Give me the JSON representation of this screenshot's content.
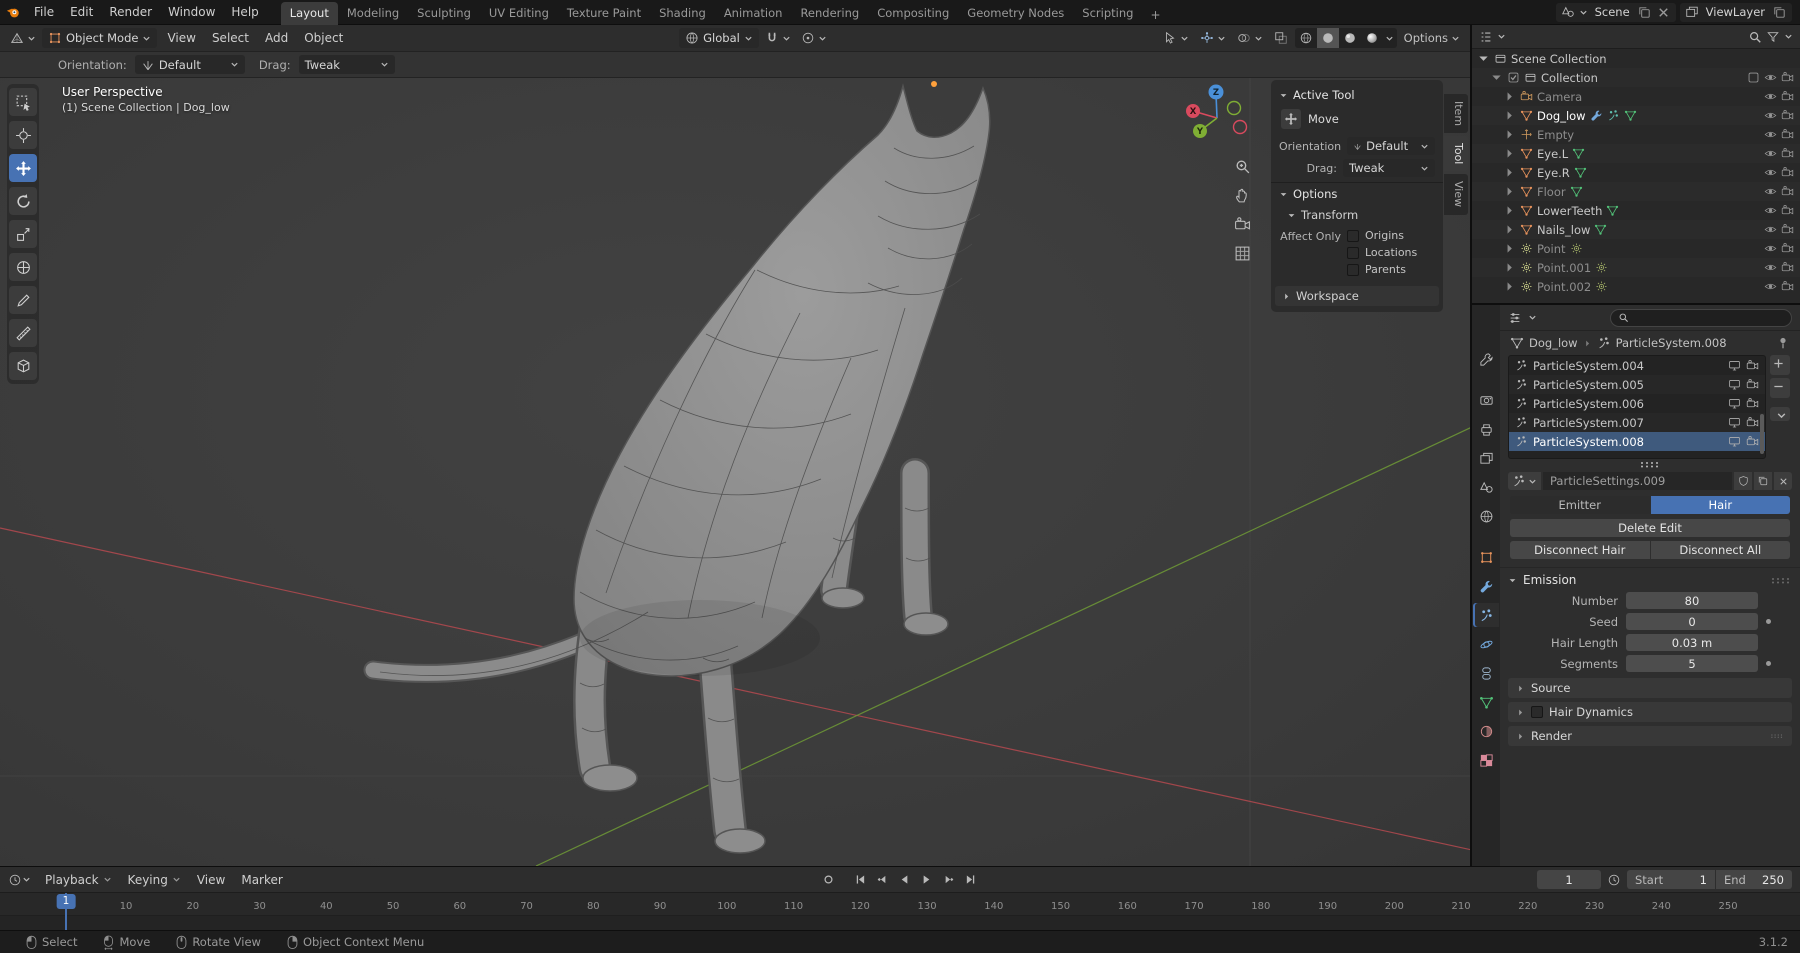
{
  "topbar": {
    "menus": [
      "File",
      "Edit",
      "Render",
      "Window",
      "Help"
    ],
    "workspaces": [
      "Layout",
      "Modeling",
      "Sculpting",
      "UV Editing",
      "Texture Paint",
      "Shading",
      "Animation",
      "Rendering",
      "Compositing",
      "Geometry Nodes",
      "Scripting"
    ],
    "active_workspace": "Layout",
    "add_workspace_label": "+",
    "scene_name": "Scene",
    "viewlayer_name": "ViewLayer"
  },
  "viewport_header": {
    "mode": "Object Mode",
    "menus": [
      "View",
      "Select",
      "Add",
      "Object"
    ],
    "orientation": "Global",
    "options_label": "Options"
  },
  "tool_settings": {
    "orientation_label": "Orientation:",
    "orientation_value": "Default",
    "drag_label": "Drag:",
    "drag_value": "Tweak"
  },
  "toolbar": {
    "tools": [
      {
        "name": "select-box",
        "active": false
      },
      {
        "name": "cursor",
        "active": false
      },
      {
        "name": "move",
        "active": true
      },
      {
        "name": "rotate",
        "active": false
      },
      {
        "name": "scale",
        "active": false
      },
      {
        "name": "transform",
        "active": false
      },
      {
        "name": "annotate",
        "active": false
      },
      {
        "name": "measure",
        "active": false
      },
      {
        "name": "add-cube",
        "active": false
      }
    ]
  },
  "viewport": {
    "view_label": "User Perspective",
    "collection_label": "(1) Scene Collection | Dog_low",
    "axis_labels": {
      "x": "X",
      "y": "Y",
      "z": "Z"
    },
    "colors": {
      "x_axis": "#b5494f",
      "y_axis": "#6f9b36",
      "accent": "#4772b3"
    }
  },
  "npanel": {
    "tabs": [
      "Item",
      "Tool",
      "View"
    ],
    "active_tab": "Tool",
    "active_tool_title": "Active Tool",
    "tool_name": "Move",
    "orientation_label": "Orientation",
    "orientation_value": "Default",
    "drag_label": "Drag:",
    "drag_value": "Tweak",
    "options_title": "Options",
    "transform_title": "Transform",
    "affect_only_label": "Affect Only",
    "checkboxes": [
      {
        "label": "Origins",
        "checked": false
      },
      {
        "label": "Locations",
        "checked": false
      },
      {
        "label": "Parents",
        "checked": false
      }
    ],
    "workspace_title": "Workspace"
  },
  "outliner": {
    "scene_collection_label": "Scene Collection",
    "rows": [
      {
        "name": "Collection",
        "icon": "collection",
        "level": 1,
        "checkbox": true,
        "expanded": true
      },
      {
        "name": "Camera",
        "icon": "camera-object",
        "level": 2,
        "dim": true
      },
      {
        "name": "Dog_low",
        "icon": "mesh-object",
        "level": 2,
        "active": true,
        "extras": [
          "modifier-wrench",
          "particles"
        ],
        "data_icon": "mesh-data"
      },
      {
        "name": "Empty",
        "icon": "empty-object",
        "level": 2,
        "dim": true
      },
      {
        "name": "Eye.L",
        "icon": "mesh-object",
        "level": 2,
        "data_icon": "mesh-data"
      },
      {
        "name": "Eye.R",
        "icon": "mesh-object",
        "level": 2,
        "data_icon": "mesh-data"
      },
      {
        "name": "Floor",
        "icon": "mesh-object",
        "level": 2,
        "dim": true,
        "data_icon": "mesh-data"
      },
      {
        "name": "LowerTeeth",
        "icon": "mesh-object",
        "level": 2,
        "data_icon": "mesh-data"
      },
      {
        "name": "Nails_low",
        "icon": "mesh-object",
        "level": 2,
        "data_icon": "mesh-data"
      },
      {
        "name": "Point",
        "icon": "light-object",
        "level": 2,
        "dim": true,
        "data_icon": "light-data"
      },
      {
        "name": "Point.001",
        "icon": "light-object",
        "level": 2,
        "dim": true,
        "data_icon": "light-data"
      },
      {
        "name": "Point.002",
        "icon": "light-object",
        "level": 2,
        "dim": true,
        "data_icon": "light-data"
      }
    ]
  },
  "properties": {
    "tabs": [
      "tool",
      "render",
      "output",
      "view-layer",
      "scene",
      "world",
      "object",
      "modifiers",
      "particles",
      "physics",
      "constraints",
      "object-data",
      "material",
      "texture"
    ],
    "active_tab": "particles",
    "breadcrumb_object": "Dog_low",
    "breadcrumb_item": "ParticleSystem.008",
    "particle_systems": [
      "ParticleSystem.004",
      "ParticleSystem.005",
      "ParticleSystem.006",
      "ParticleSystem.007",
      "ParticleSystem.008"
    ],
    "selected_system": "ParticleSystem.008",
    "settings_name": "ParticleSettings.009",
    "type_emitter": "Emitter",
    "type_hair": "Hair",
    "active_type": "Hair",
    "delete_edit_label": "Delete Edit",
    "disconnect_hair_label": "Disconnect Hair",
    "disconnect_all_label": "Disconnect All",
    "emission_title": "Emission",
    "emission_fields": [
      {
        "label": "Number",
        "value": "80",
        "anim_dot": false
      },
      {
        "label": "Seed",
        "value": "0",
        "anim_dot": true
      },
      {
        "label": "Hair Length",
        "value": "0.03 m",
        "anim_dot": false
      },
      {
        "label": "Segments",
        "value": "5",
        "anim_dot": true
      }
    ],
    "collapsed_sections": [
      {
        "title": "Source",
        "checkbox": false
      },
      {
        "title": "Hair Dynamics",
        "checkbox": true
      },
      {
        "title": "Render",
        "checkbox": false
      }
    ]
  },
  "timeline": {
    "menus": [
      "Playback",
      "Keying",
      "View",
      "Marker"
    ],
    "current_frame": "1",
    "start_label": "Start",
    "start_value": "1",
    "end_label": "End",
    "end_value": "250",
    "playhead_frame": 1,
    "ticks": [
      10,
      20,
      30,
      40,
      50,
      60,
      70,
      80,
      90,
      100,
      110,
      120,
      130,
      140,
      150,
      160,
      170,
      180,
      190,
      200,
      210,
      220,
      230,
      240,
      250
    ]
  },
  "statusbar": {
    "hints": [
      {
        "icon": "mouse-left",
        "label": "Select"
      },
      {
        "icon": "mouse-left-drag",
        "label": "Move"
      },
      {
        "icon": "mouse-middle",
        "label": "Rotate View"
      },
      {
        "icon": "mouse-right",
        "label": "Object Context Menu"
      }
    ],
    "version": "3.1.2"
  }
}
